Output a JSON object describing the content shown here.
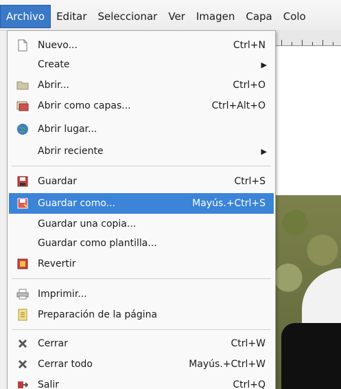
{
  "menubar": {
    "items": [
      "Archivo",
      "Editar",
      "Seleccionar",
      "Ver",
      "Imagen",
      "Capa",
      "Colo"
    ],
    "active_index": 0
  },
  "menu": {
    "items": [
      {
        "label": "Nuevo...",
        "shortcut": "Ctrl+N",
        "icon": "new-document-icon",
        "submenu": false
      },
      {
        "label": "Create",
        "shortcut": "",
        "icon": "",
        "submenu": true
      },
      {
        "label": "Abrir...",
        "shortcut": "Ctrl+O",
        "icon": "open-folder-icon",
        "submenu": false
      },
      {
        "label": "Abrir como capas...",
        "shortcut": "Ctrl+Alt+O",
        "icon": "open-as-layers-icon",
        "submenu": false
      },
      {
        "label": "Abrir lugar...",
        "shortcut": "",
        "icon": "globe-icon",
        "submenu": false
      },
      {
        "label": "Abrir reciente",
        "shortcut": "",
        "icon": "",
        "submenu": true
      },
      {
        "label": "Guardar",
        "shortcut": "Ctrl+S",
        "icon": "save-icon",
        "submenu": false
      },
      {
        "label": "Guardar como...",
        "shortcut": "Mayús.+Ctrl+S",
        "icon": "save-as-icon",
        "submenu": false,
        "highlighted": true
      },
      {
        "label": "Guardar una copia...",
        "shortcut": "",
        "icon": "",
        "submenu": false
      },
      {
        "label": "Guardar como plantilla...",
        "shortcut": "",
        "icon": "",
        "submenu": false
      },
      {
        "label": "Revertir",
        "shortcut": "",
        "icon": "revert-icon",
        "submenu": false
      },
      {
        "label": "Imprimir...",
        "shortcut": "",
        "icon": "printer-icon",
        "submenu": false
      },
      {
        "label": "Preparación de la página",
        "shortcut": "",
        "icon": "page-setup-icon",
        "submenu": false
      },
      {
        "label": "Cerrar",
        "shortcut": "Ctrl+W",
        "icon": "close-x-icon",
        "submenu": false
      },
      {
        "label": "Cerrar todo",
        "shortcut": "Mayús.+Ctrl+W",
        "icon": "close-all-icon",
        "submenu": false
      },
      {
        "label": "Salir",
        "shortcut": "Ctrl+Q",
        "icon": "quit-icon",
        "submenu": false
      }
    ]
  },
  "colors": {
    "highlight": "#3b84d8",
    "menubar_active": "#3a78c8"
  }
}
